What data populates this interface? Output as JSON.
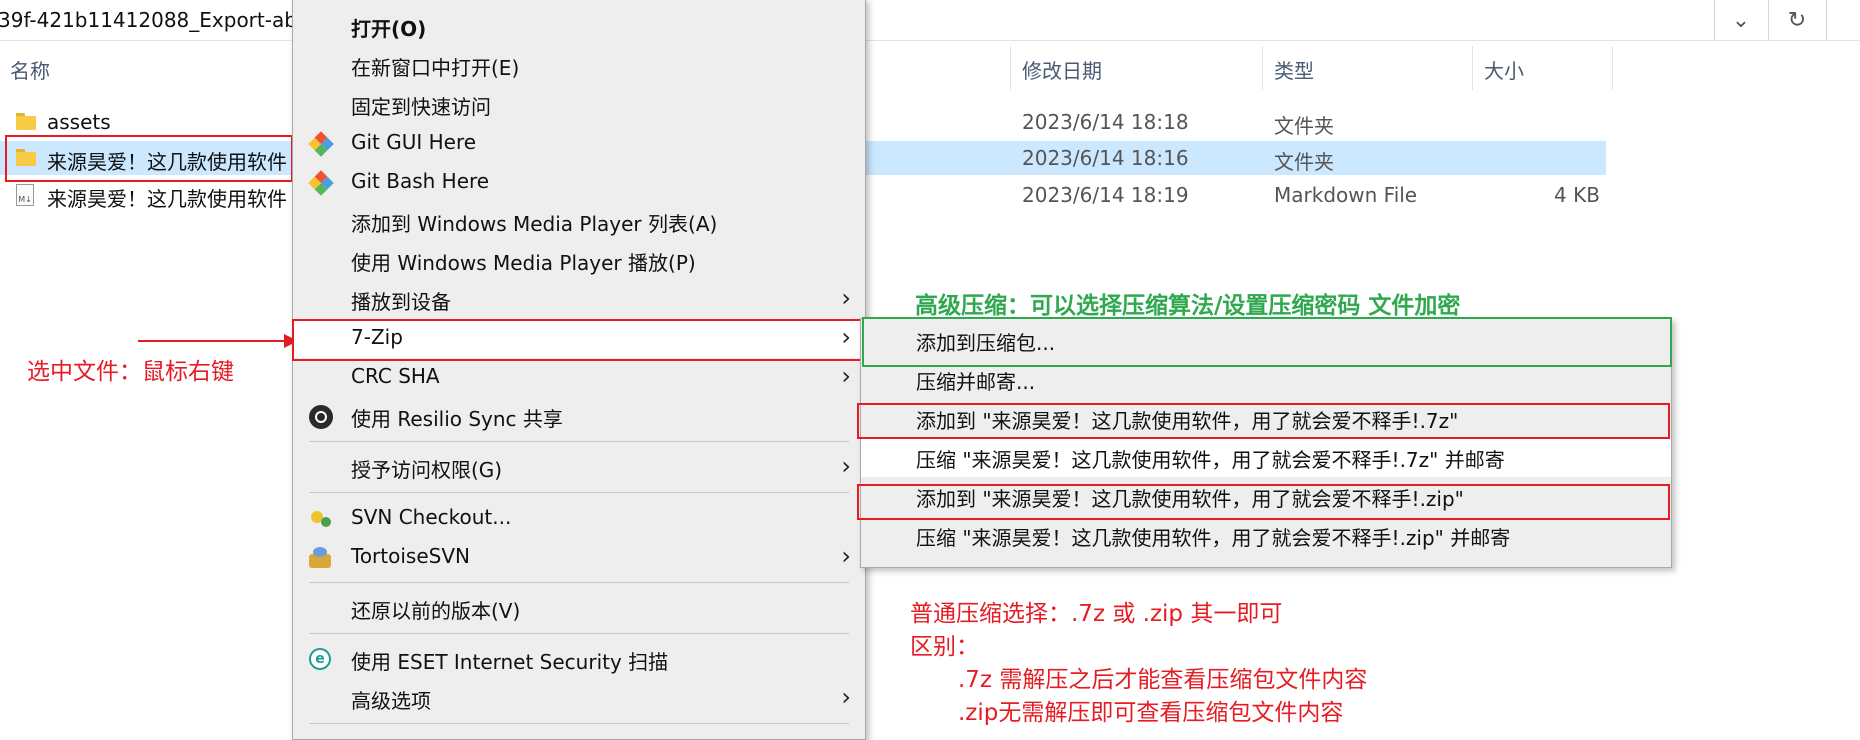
{
  "address_bar": {
    "path": "39f-421b11412088_Export-ab",
    "dropdown_icon": "chevron-down-icon",
    "refresh_icon": "refresh-icon"
  },
  "columns": {
    "name": "名称",
    "date": "修改日期",
    "type": "类型",
    "size": "大小"
  },
  "files": [
    {
      "name": "assets",
      "date": "2023/6/14 18:18",
      "type": "文件夹",
      "size": "",
      "icon": "folder-icon"
    },
    {
      "name": "来源昊爱！这几款使用软件",
      "date": "2023/6/14 18:16",
      "type": "文件夹",
      "size": "",
      "icon": "folder-icon"
    },
    {
      "name": "来源昊爱！这几款使用软件",
      "date": "2023/6/14 18:19",
      "type": "Markdown File",
      "size": "4 KB",
      "icon": "markdown-file-icon"
    }
  ],
  "context_menu": {
    "items": [
      {
        "label": "打开(O)"
      },
      {
        "label": "在新窗口中打开(E)"
      },
      {
        "label": "固定到快速访问"
      },
      {
        "label": "Git GUI Here",
        "icon": "git-icon"
      },
      {
        "label": "Git Bash Here",
        "icon": "git-icon"
      },
      {
        "label": "添加到 Windows Media Player 列表(A)"
      },
      {
        "label": "使用 Windows Media Player 播放(P)"
      },
      {
        "label": "播放到设备"
      },
      {
        "label": "7-Zip"
      },
      {
        "label": "CRC SHA"
      },
      {
        "label": "使用 Resilio Sync 共享",
        "icon": "resilio-icon"
      },
      {
        "label": "授予访问权限(G)"
      },
      {
        "label": "SVN Checkout...",
        "icon": "svn-icon"
      },
      {
        "label": "TortoiseSVN",
        "icon": "tortoisesvn-icon"
      },
      {
        "label": "还原以前的版本(V)"
      },
      {
        "label": "使用 ESET Internet Security 扫描",
        "icon": "eset-icon"
      },
      {
        "label": "高级选项"
      }
    ]
  },
  "submenu_7zip": {
    "items": [
      {
        "label": "添加到压缩包..."
      },
      {
        "label": "压缩并邮寄..."
      },
      {
        "label": "添加到 \"来源昊爱！这几款使用软件，用了就会爱不释手!.7z\""
      },
      {
        "label": "压缩 \"来源昊爱！这几款使用软件，用了就会爱不释手!.7z\" 并邮寄"
      },
      {
        "label": "添加到 \"来源昊爱！这几款使用软件，用了就会爱不释手!.zip\""
      },
      {
        "label": "压缩 \"来源昊爱！这几款使用软件，用了就会爱不释手!.zip\" 并邮寄"
      }
    ]
  },
  "annotations": {
    "select_hint": "选中文件：鼠标右键",
    "advanced_hint": "高级压缩：可以选择压缩算法/设置压缩密码   文件加密",
    "normal_hint": "普通压缩选择：.7z  或 .zip 其一即可",
    "diff_title": "区别：",
    "diff_7z": ".7z 需解压之后才能查看压缩包文件内容",
    "diff_zip": ".zip无需解压即可查看压缩包文件内容"
  },
  "colors": {
    "selection": "#cce8ff",
    "annotation_red": "#e51c23",
    "annotation_green": "#2fa84f",
    "menu_bg": "#eeeeee"
  }
}
